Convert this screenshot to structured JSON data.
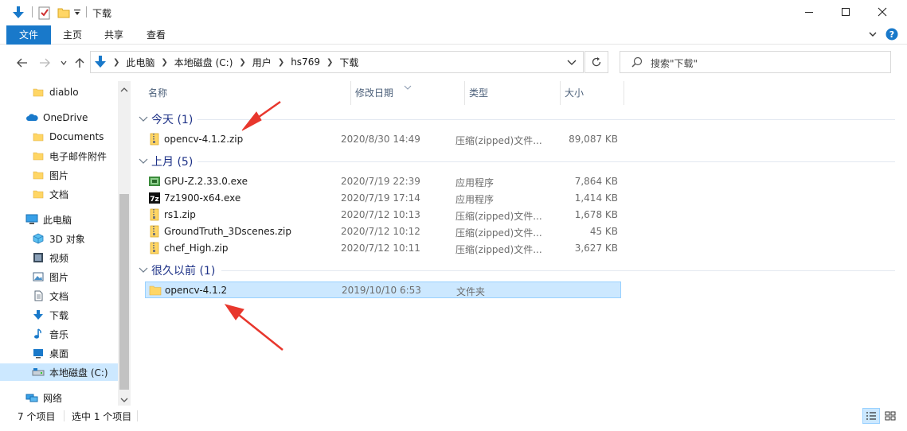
{
  "window": {
    "title": "下载",
    "minimize": "minimize",
    "maximize": "maximize",
    "close": "close"
  },
  "ribbon": {
    "tabs": [
      "文件",
      "主页",
      "共享",
      "查看"
    ]
  },
  "address": {
    "crumbs": [
      "此电脑",
      "本地磁盘 (C:)",
      "用户",
      "hs769",
      "下载"
    ]
  },
  "search": {
    "placeholder": "搜索\"下载\""
  },
  "sidebar": {
    "items": [
      {
        "label": "diablo",
        "icon": "folder-icon"
      },
      {
        "label": "OneDrive",
        "icon": "cloud-icon"
      },
      {
        "label": "Documents",
        "icon": "folder-icon"
      },
      {
        "label": "电子邮件附件",
        "icon": "folder-icon"
      },
      {
        "label": "图片",
        "icon": "folder-icon"
      },
      {
        "label": "文档",
        "icon": "folder-icon"
      },
      {
        "label": "此电脑",
        "icon": "computer-icon"
      },
      {
        "label": "3D 对象",
        "icon": "cube-icon"
      },
      {
        "label": "视频",
        "icon": "video-icon"
      },
      {
        "label": "图片",
        "icon": "picture-icon"
      },
      {
        "label": "文档",
        "icon": "document-icon"
      },
      {
        "label": "下载",
        "icon": "download-icon"
      },
      {
        "label": "音乐",
        "icon": "music-icon"
      },
      {
        "label": "桌面",
        "icon": "desktop-icon"
      },
      {
        "label": "本地磁盘 (C:)",
        "icon": "drive-icon"
      },
      {
        "label": "网络",
        "icon": "network-icon"
      }
    ]
  },
  "columns": {
    "name": "名称",
    "date": "修改日期",
    "type": "类型",
    "size": "大小"
  },
  "groups": [
    {
      "label": "今天 (1)",
      "files": [
        {
          "name": "opencv-4.1.2.zip",
          "date": "2020/8/30 14:49",
          "type": "压缩(zipped)文件...",
          "size": "89,087 KB",
          "icon": "zip-icon"
        }
      ]
    },
    {
      "label": "上月 (5)",
      "files": [
        {
          "name": "GPU-Z.2.33.0.exe",
          "date": "2020/7/19 22:39",
          "type": "应用程序",
          "size": "7,864 KB",
          "icon": "gpuz-icon"
        },
        {
          "name": "7z1900-x64.exe",
          "date": "2020/7/19 17:14",
          "type": "应用程序",
          "size": "1,414 KB",
          "icon": "7zip-icon"
        },
        {
          "name": "rs1.zip",
          "date": "2020/7/12 10:13",
          "type": "压缩(zipped)文件...",
          "size": "1,678 KB",
          "icon": "zip-icon"
        },
        {
          "name": "GroundTruth_3Dscenes.zip",
          "date": "2020/7/12 10:12",
          "type": "压缩(zipped)文件...",
          "size": "45 KB",
          "icon": "zip-icon"
        },
        {
          "name": "chef_High.zip",
          "date": "2020/7/12 10:11",
          "type": "压缩(zipped)文件...",
          "size": "3,627 KB",
          "icon": "zip-icon"
        }
      ]
    },
    {
      "label": "很久以前 (1)",
      "files": [
        {
          "name": "opencv-4.1.2",
          "date": "2019/10/10 6:53",
          "type": "文件夹",
          "size": "",
          "icon": "folder-icon"
        }
      ]
    }
  ],
  "status": {
    "count": "7 个项目",
    "selected": "选中 1 个项目"
  },
  "colors": {
    "accent": "#1979ca",
    "selection": "#cce8ff",
    "annotation": "#e8372d"
  }
}
